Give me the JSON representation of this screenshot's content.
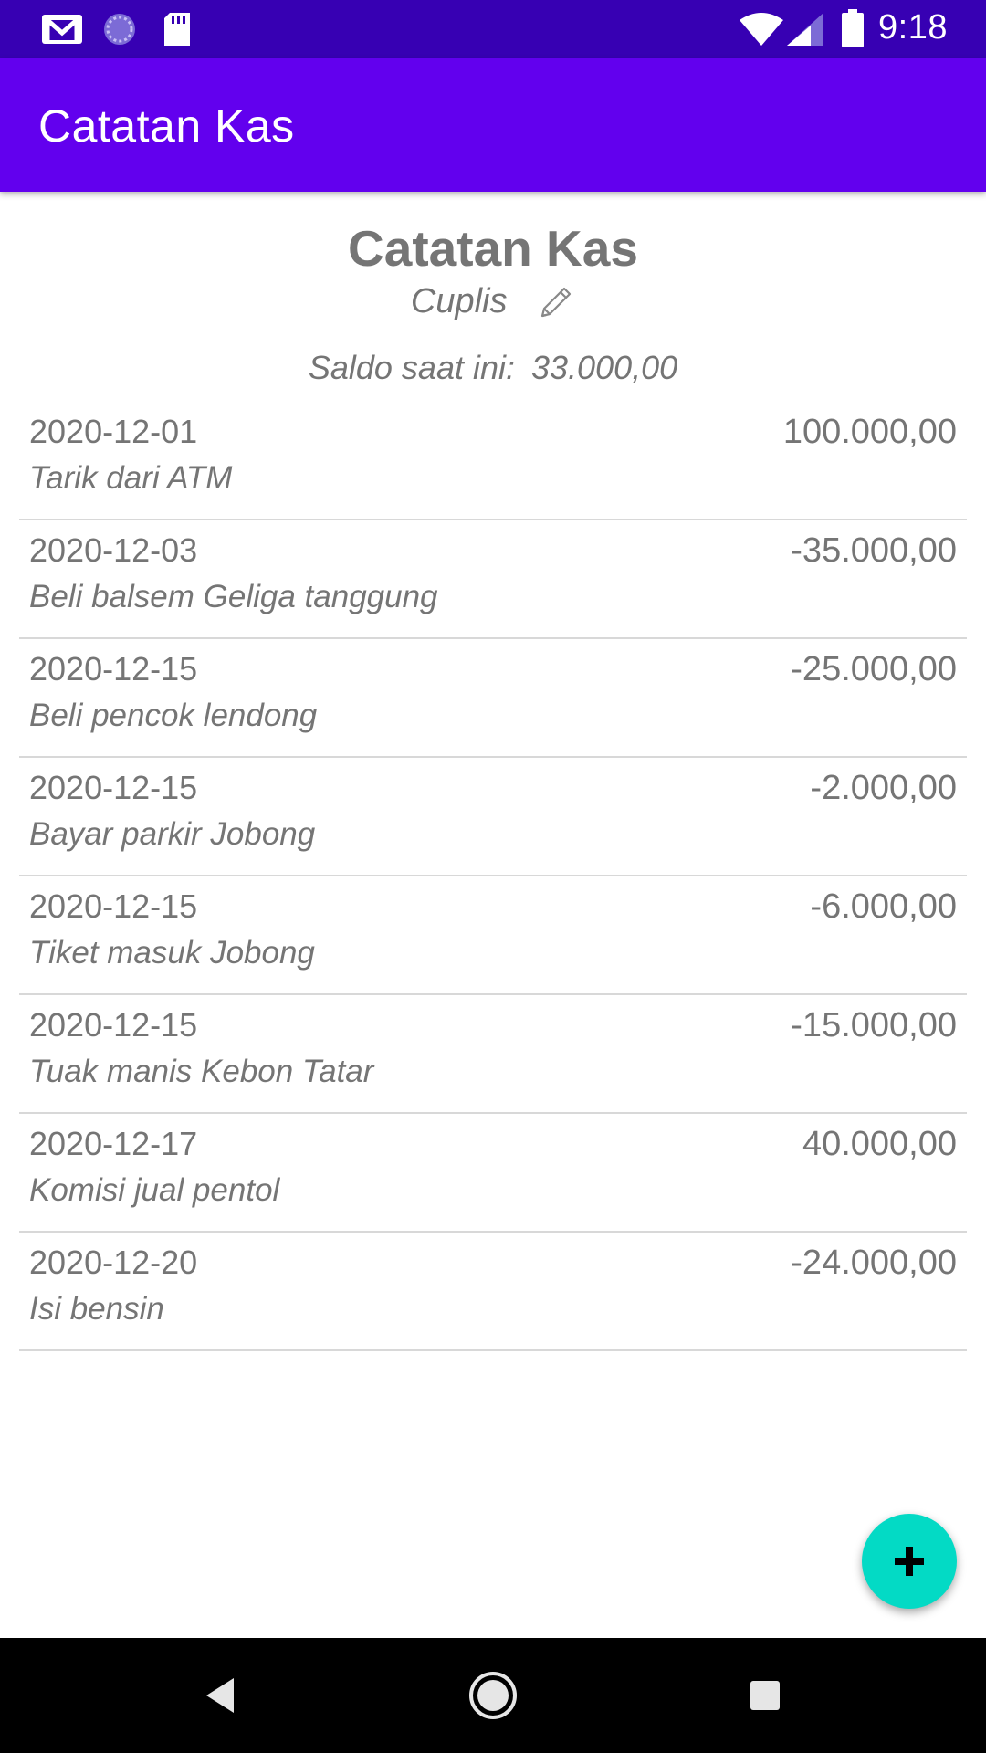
{
  "status_bar": {
    "time": "9:18",
    "left_icons": [
      "gmail-icon",
      "sync-icon",
      "sd-card-icon"
    ],
    "right_icons": [
      "wifi-icon",
      "signal-icon",
      "battery-icon"
    ]
  },
  "app_bar": {
    "title": "Catatan Kas"
  },
  "header": {
    "title": "Catatan Kas",
    "owner": "Cuplis",
    "edit_icon": "pencil-icon",
    "balance_label": "Saldo saat ini:",
    "balance_value": "33.000,00"
  },
  "transactions": [
    {
      "date": "2020-12-01",
      "description": "Tarik dari ATM",
      "amount": "100.000,00"
    },
    {
      "date": "2020-12-03",
      "description": "Beli balsem Geliga tanggung",
      "amount": "-35.000,00"
    },
    {
      "date": "2020-12-15",
      "description": "Beli pencok lendong",
      "amount": "-25.000,00"
    },
    {
      "date": "2020-12-15",
      "description": "Bayar parkir Jobong",
      "amount": "-2.000,00"
    },
    {
      "date": "2020-12-15",
      "description": "Tiket masuk Jobong",
      "amount": "-6.000,00"
    },
    {
      "date": "2020-12-15",
      "description": "Tuak manis Kebon Tatar",
      "amount": "-15.000,00"
    },
    {
      "date": "2020-12-17",
      "description": "Komisi jual pentol",
      "amount": "40.000,00"
    },
    {
      "date": "2020-12-20",
      "description": "Isi bensin",
      "amount": "-24.000,00"
    }
  ],
  "fab": {
    "icon": "plus-icon"
  },
  "nav_bar": {
    "buttons": [
      "back-icon",
      "home-icon",
      "recents-icon"
    ]
  },
  "colors": {
    "status_bar": "#3700b3",
    "app_bar": "#6200ee",
    "fab": "#03dac5",
    "text": "#757575",
    "divider": "#d8d8d8"
  }
}
